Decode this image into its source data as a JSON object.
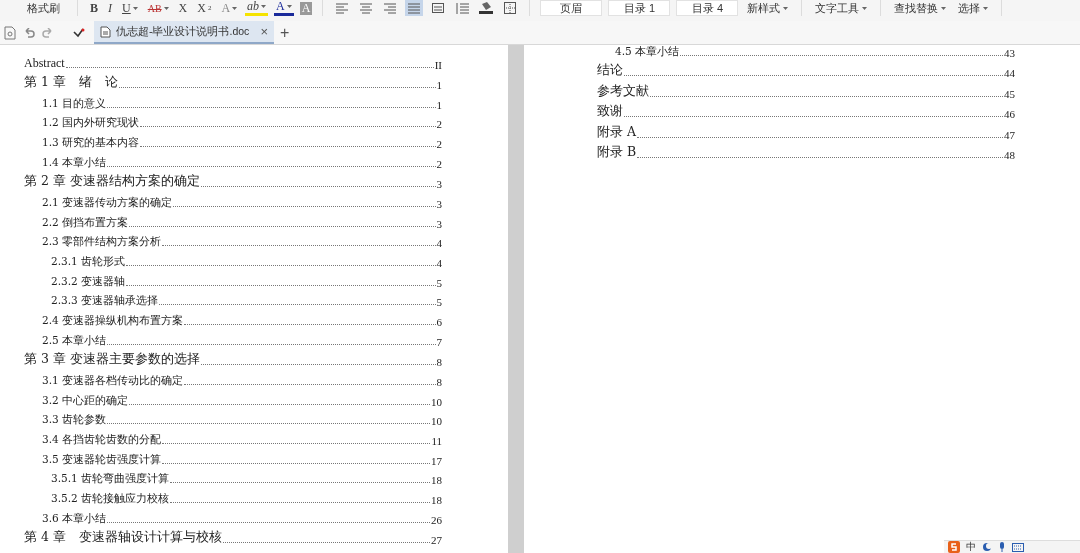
{
  "ribbon": {
    "clipboard_label": "格式刷",
    "format_buttons": [
      {
        "kind": "bold",
        "label": "B"
      },
      {
        "kind": "italic",
        "label": "I"
      },
      {
        "kind": "underline",
        "label": "U",
        "dropdown": true
      },
      {
        "kind": "strike",
        "label": "AB",
        "dropdown": true
      },
      {
        "kind": "plain",
        "label": "X"
      },
      {
        "kind": "sub",
        "label": "X",
        "sub": "2"
      },
      {
        "kind": "outline",
        "label": "A",
        "dropdown": true
      },
      {
        "kind": "highlight",
        "label": "ab",
        "dropdown": true
      },
      {
        "kind": "color",
        "label": "A",
        "dropdown": true
      },
      {
        "kind": "shade",
        "label": "A"
      }
    ],
    "paragraph_tools": [
      {
        "kind": "align-left",
        "selected": false
      },
      {
        "kind": "align-center",
        "selected": false
      },
      {
        "kind": "align-right",
        "selected": false
      },
      {
        "kind": "justify",
        "selected": true
      },
      {
        "kind": "distribute",
        "selected": false
      },
      {
        "kind": "line-spacing",
        "selected": false
      },
      {
        "kind": "fill",
        "selected": false
      },
      {
        "kind": "border",
        "selected": false
      }
    ],
    "styles": [
      "页眉",
      "目录 1",
      "目录 4"
    ],
    "new_style_menu": "新样式",
    "text_tools_menu": "文字工具",
    "find_menus": [
      "查找替换",
      "选择"
    ]
  },
  "tabbar": {
    "tabs": [
      {
        "title": "仇志超-毕业设计说明书.doc",
        "selected": true,
        "close": "×"
      }
    ],
    "new_tab": "+"
  },
  "pages": [
    {
      "entries": [
        {
          "label": "Abstract",
          "page": "II",
          "kind": "latin"
        },
        {
          "label": "第 1 章　绪　论",
          "page": "1",
          "children": [
            {
              "label": "1.1  目的意义",
              "page": "1"
            },
            {
              "label": "1.2  国内外研究现状",
              "page": "2"
            },
            {
              "label": "1.3  研究的基本内容",
              "page": "2"
            },
            {
              "label": "1.4  本章小结",
              "page": "2"
            }
          ]
        },
        {
          "label": "第 2 章  变速器结构方案的确定",
          "page": "3",
          "children": [
            {
              "label": "2.1  变速器传动方案的确定",
              "page": "3"
            },
            {
              "label": "2.2  倒挡布置方案",
              "page": "3"
            },
            {
              "label": "2.3 零部件结构方案分析",
              "page": "4",
              "children": [
                {
                  "label": "2.3.1 齿轮形式",
                  "page": "4"
                },
                {
                  "label": "2.3.2 变速器轴",
                  "page": "5"
                },
                {
                  "label": "2.3.3 变速器轴承选择",
                  "page": "5"
                }
              ]
            },
            {
              "label": "2.4 变速器操纵机构布置方案",
              "page": "6"
            },
            {
              "label": "2.5 本章小结",
              "page": "7"
            }
          ]
        },
        {
          "label": "第 3 章  变速器主要参数的选择",
          "page": "8",
          "children": [
            {
              "label": "3.1 变速器各档传动比的确定",
              "page": "8"
            },
            {
              "label": "3.2 中心距的确定",
              "page": "10"
            },
            {
              "label": "3.3 齿轮参数",
              "page": "10"
            },
            {
              "label": "3.4 各挡齿轮齿数的分配",
              "page": "11"
            },
            {
              "label": "3.5 变速器轮齿强度计算",
              "page": "17",
              "children": [
                {
                  "label": "3.5.1 齿轮弯曲强度计算",
                  "page": "18"
                },
                {
                  "label": "3.5.2 齿轮接触应力校核",
                  "page": "18"
                }
              ]
            },
            {
              "label": "3.6 本章小结",
              "page": "26"
            }
          ]
        },
        {
          "label": "第 4 章　变速器轴设计计算与校核",
          "page": "27"
        }
      ]
    },
    {
      "entries": [
        {
          "children": [
            {
              "label": "4.5  本章小结",
              "page": "43"
            }
          ]
        },
        {
          "label": "结论",
          "page": "44"
        },
        {
          "label": "参考文献",
          "page": "45"
        },
        {
          "label": "致谢",
          "page": "46"
        },
        {
          "label": "附录  A",
          "page": "47"
        },
        {
          "label": "附录  B",
          "page": "48"
        }
      ]
    }
  ],
  "ime_bar": {
    "label": "中"
  }
}
